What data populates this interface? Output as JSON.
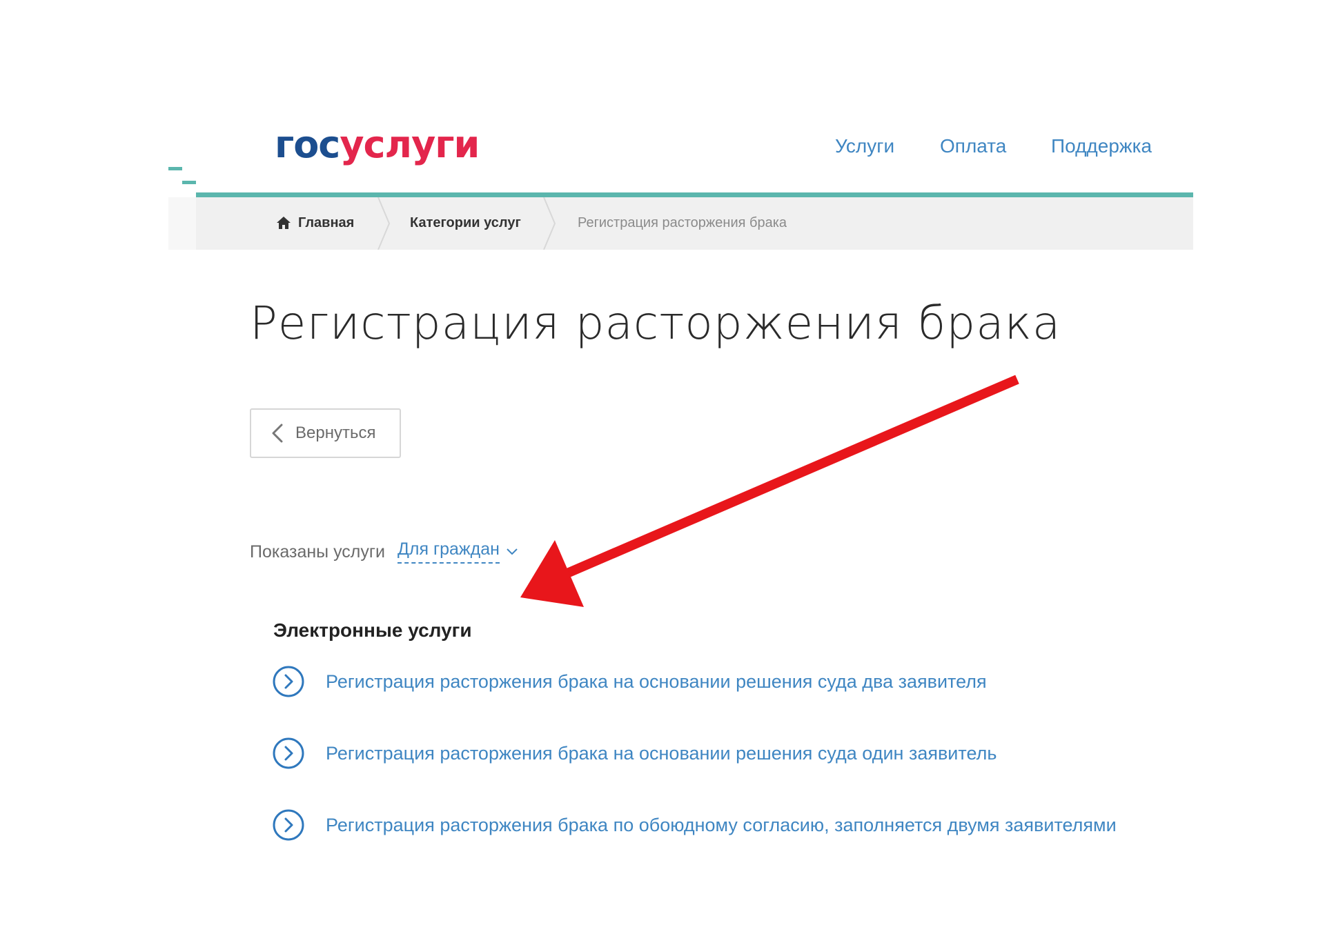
{
  "header": {
    "logo": {
      "part1": "гос",
      "part2": "услуги"
    },
    "nav": [
      {
        "label": "Услуги"
      },
      {
        "label": "Оплата"
      },
      {
        "label": "Поддержка"
      }
    ]
  },
  "breadcrumb": {
    "home": "Главная",
    "category": "Категории услуг",
    "current": "Регистрация расторжения брака"
  },
  "page": {
    "title": "Регистрация расторжения брака",
    "back_label": "Вернуться"
  },
  "filter": {
    "label": "Показаны услуги",
    "value": "Для граждан"
  },
  "services": {
    "section_title": "Электронные услуги",
    "items": [
      {
        "label": "Регистрация расторжения брака на основании решения суда два заявителя"
      },
      {
        "label": "Регистрация расторжения брака на основании решения суда один заявитель"
      },
      {
        "label": "Регистрация расторжения брака по обоюдному согласию, заполняется двумя заявителями"
      }
    ]
  },
  "colors": {
    "accent": "#5bb6ad",
    "link": "#3f86c2",
    "logo_blue": "#1c4e8f",
    "logo_red": "#e3264c",
    "annotation_arrow": "#e8161b"
  },
  "icons": [
    "home-icon",
    "chevron-left-icon",
    "chevron-down-icon",
    "circle-chevron-right-icon",
    "red-arrow-annotation"
  ]
}
